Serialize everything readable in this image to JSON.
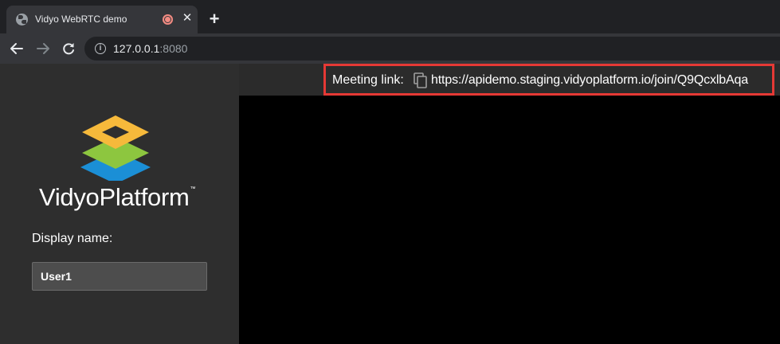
{
  "browser": {
    "tab": {
      "title": "Vidyo WebRTC demo",
      "favicon": "globe-icon",
      "recording_indicator": "record-icon",
      "close_glyph": "✕"
    },
    "new_tab_glyph": "+",
    "nav": {
      "back": "back-arrow-icon",
      "forward": "forward-arrow-icon",
      "reload": "reload-icon"
    },
    "url": {
      "host": "127.0.0.1",
      "port": ":8080"
    }
  },
  "sidebar": {
    "brand": "VidyoPlatform",
    "trademark": "™",
    "display_name_label": "Display name:",
    "display_name_value": "User1"
  },
  "topbar": {
    "meeting_link_label": "Meeting link:",
    "copy_icon": "copy-icon",
    "meeting_url": "https://apidemo.staging.vidyoplatform.io/join/Q9QcxlbAqa",
    "highlight_color": "#e53935"
  },
  "colors": {
    "logo_top": "#f6b93b",
    "logo_middle": "#8dc63f",
    "logo_bottom": "#1b8fd6"
  }
}
